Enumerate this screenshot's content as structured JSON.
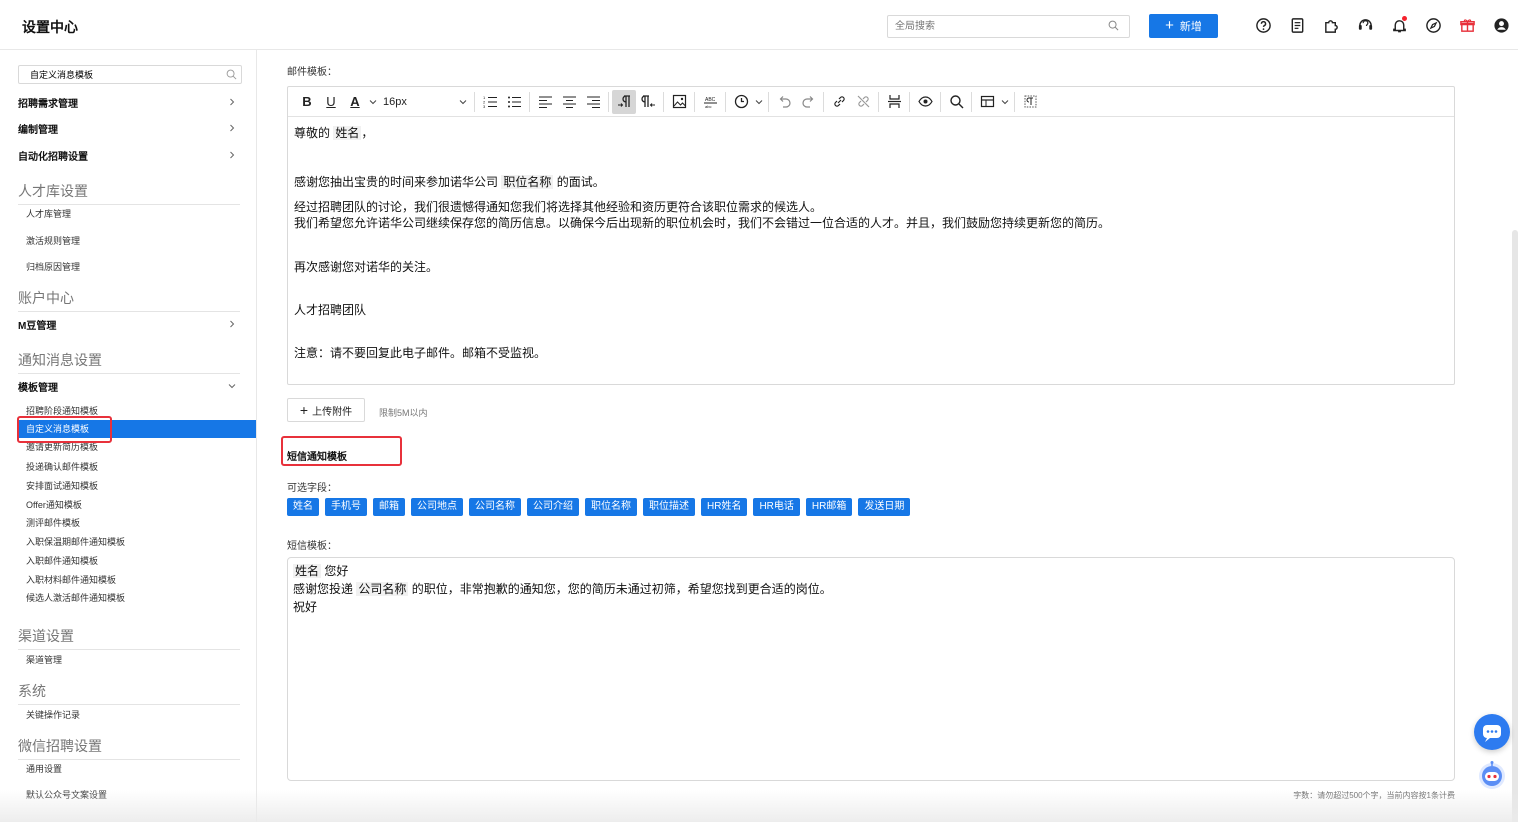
{
  "header": {
    "title": "设置中心",
    "search_placeholder": "全局搜索",
    "new_button": "新增"
  },
  "sidebar": {
    "search_value": "自定义消息模板",
    "groups_top": [
      {
        "label": "招聘需求管理"
      },
      {
        "label": "编制管理"
      },
      {
        "label": "自动化招聘设置"
      }
    ],
    "talent": {
      "title": "人才库设置",
      "items": [
        "人才库管理",
        "激活规则管理",
        "归档原因管理"
      ]
    },
    "account": {
      "title": "账户中心",
      "group": "M豆管理"
    },
    "notify": {
      "title": "通知消息设置",
      "group": "模板管理",
      "items": [
        "招聘阶段通知模板",
        "自定义消息模板",
        "邀请更新简历模板",
        "投递确认邮件模板",
        "安排面试通知模板",
        "Offer通知模板",
        "测评邮件模板",
        "入职保温期邮件通知模板",
        "入职邮件通知模板",
        "入职材料邮件通知模板",
        "候选人激活邮件通知模板"
      ]
    },
    "channel": {
      "title": "渠道设置",
      "items": [
        "渠道管理"
      ]
    },
    "system": {
      "title": "系统",
      "items": [
        "关键操作记录"
      ]
    },
    "wechat": {
      "title": "微信招聘设置",
      "items": [
        "通用设置",
        "默认公众号文案设置"
      ]
    }
  },
  "email": {
    "label": "邮件模板：",
    "toolbar": {
      "font_size": "16px"
    },
    "lines": {
      "greeting_pre": "尊敬的 ",
      "greeting_chip": "姓名",
      "greeting_post": "，",
      "thanks_pre": "感谢您抽出宝贵的时间来参加诺华公司 ",
      "thanks_chip": "职位名称",
      "thanks_post": " 的面试。",
      "p1": "经过招聘团队的讨论，我们很遗憾得通知您我们将选择其他经验和资历更符合该职位需求的候选人。",
      "p2": "我们希望您允许诺华公司继续保存您的简历信息。以确保今后出现新的职位机会时，我们不会错过一位合适的人才。并且，我们鼓励您持续更新您的简历。",
      "p3": "再次感谢您对诺华的关注。",
      "p4": "人才招聘团队",
      "p5": "注意：请不要回复此电子邮件。邮箱不受监视。"
    },
    "upload_button": "上传附件",
    "upload_hint": "限制5M以内"
  },
  "sms": {
    "title": "短信通知模板",
    "fields_label": "可选字段：",
    "fields": [
      "姓名",
      "手机号",
      "邮箱",
      "公司地点",
      "公司名称",
      "公司介绍",
      "职位名称",
      "职位描述",
      "HR姓名",
      "HR电话",
      "HR邮箱",
      "发送日期"
    ],
    "template_label": "短信模板：",
    "line1_chip": "姓名",
    "line1_post": " 您好",
    "line2_pre": "感谢您投递 ",
    "line2_chip": "公司名称",
    "line2_post": " 的职位，非常抱歉的通知您，您的简历未通过初筛，希望您找到更合适的岗位。",
    "line3": "祝好",
    "count_hint": "字数：请勿超过500个字，当前内容按1条计费"
  },
  "colors": {
    "primary": "#1677e6",
    "highlight": "#e8313b"
  }
}
